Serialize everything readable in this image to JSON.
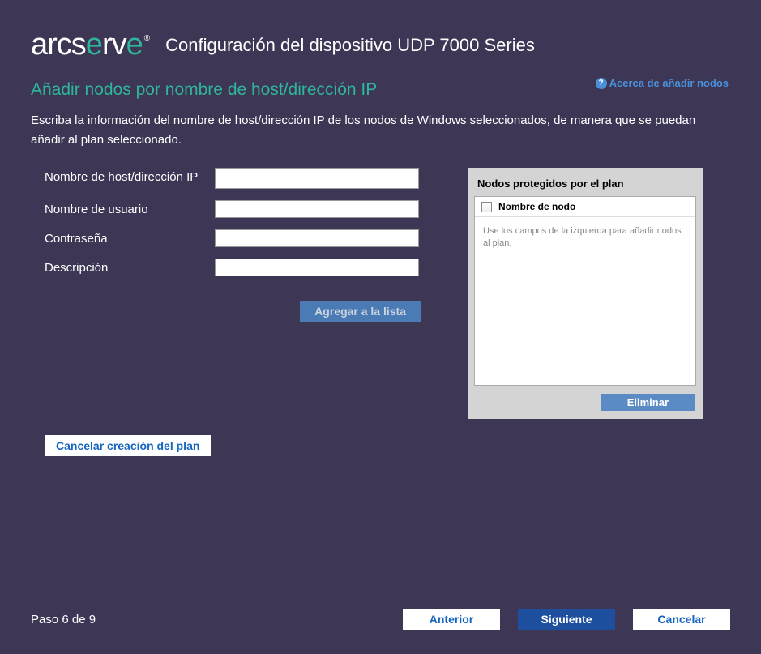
{
  "header": {
    "logo_text": "arcserve",
    "title": "Configuración del dispositivo UDP 7000 Series"
  },
  "page": {
    "title": "Añadir nodos por nombre de host/dirección IP",
    "help_link": "Acerca de añadir nodos",
    "description": "Escriba la información del nombre de host/dirección IP de los nodos de Windows seleccionados, de manera que se puedan añadir al plan seleccionado."
  },
  "form": {
    "hostname_label": "Nombre de host/dirección IP",
    "hostname_value": "",
    "username_label": "Nombre de usuario",
    "username_value": "",
    "password_label": "Contraseña",
    "password_value": "",
    "description_label": "Descripción",
    "description_value": "",
    "add_button": "Agregar a la lista"
  },
  "panel": {
    "title": "Nodos protegidos por el plan",
    "column_name": "Nombre de nodo",
    "empty_text": "Use los campos de la izquierda para añadir nodos al plan.",
    "delete_button": "Eliminar"
  },
  "actions": {
    "cancel_plan": "Cancelar creación del plan"
  },
  "footer": {
    "step_text": "Paso 6 de 9",
    "prev_button": "Anterior",
    "next_button": "Siguiente",
    "cancel_button": "Cancelar"
  }
}
